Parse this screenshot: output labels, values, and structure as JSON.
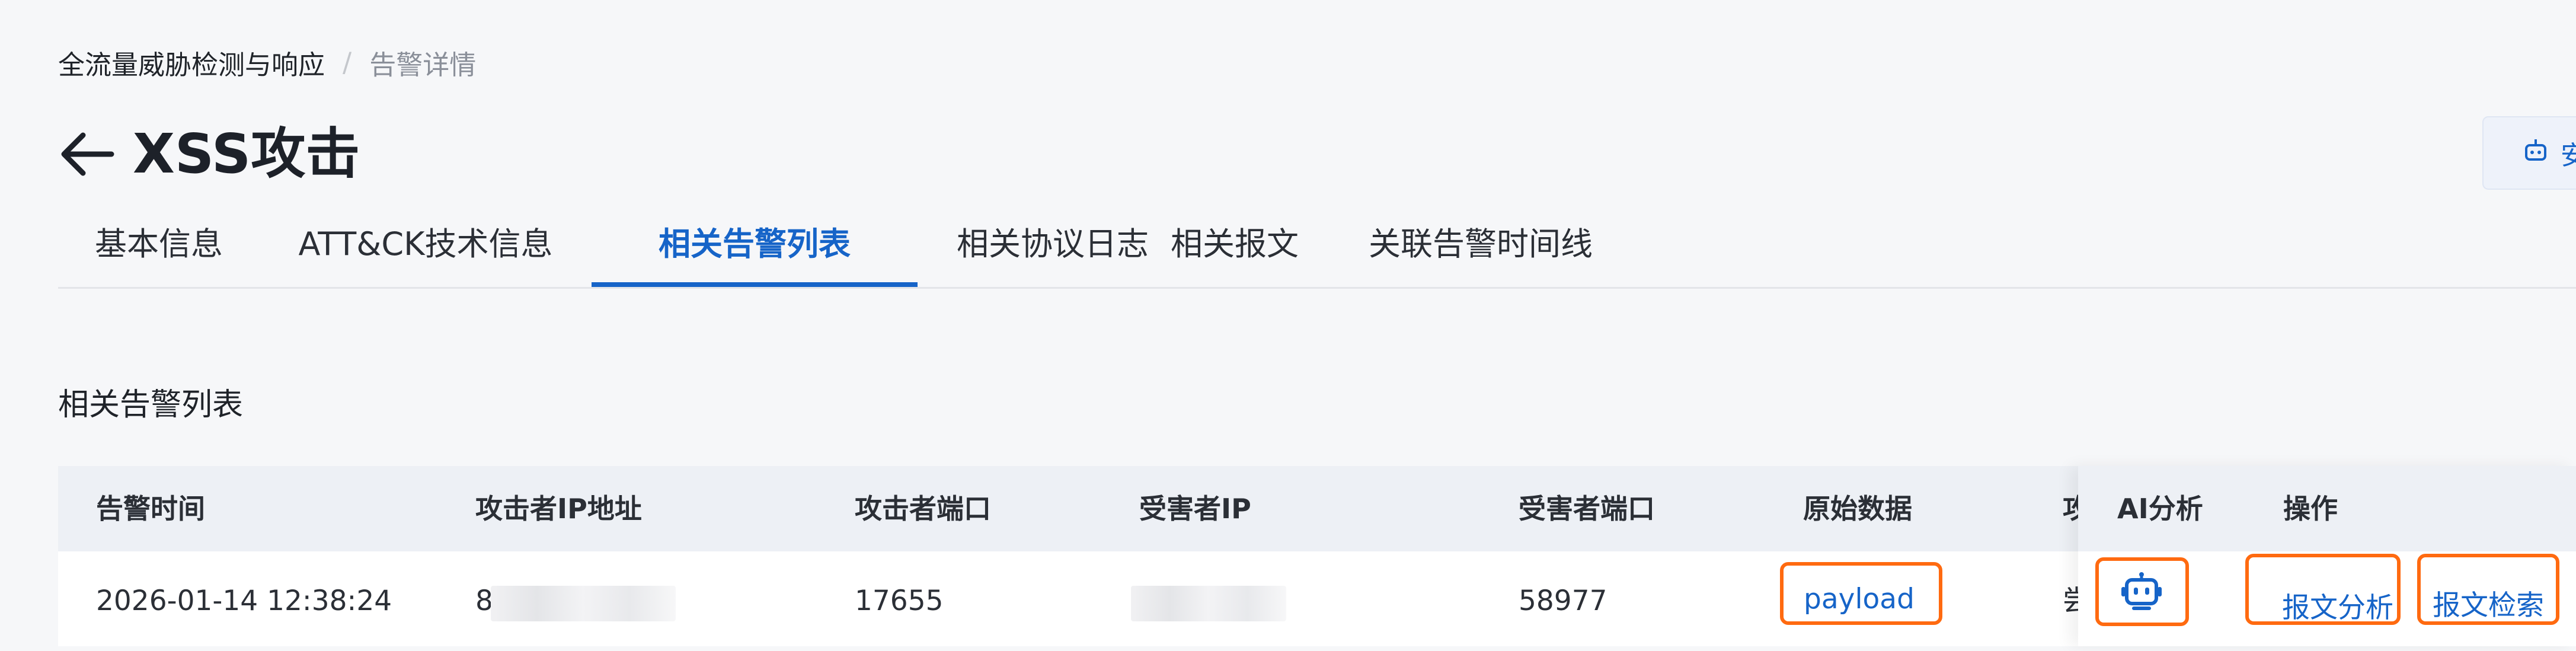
{
  "breadcrumb": {
    "root": "全流量威胁检测与响应",
    "separator": "/",
    "current": "告警详情"
  },
  "header": {
    "title": "XSS攻击",
    "back_icon": "arrow-left-icon",
    "right_button_label": "安",
    "right_button_icon": "robot-icon"
  },
  "tabs": [
    {
      "label": "基本信息",
      "active": false
    },
    {
      "label": "ATT&CK技术信息",
      "active": false
    },
    {
      "label": "相关告警列表",
      "active": true
    },
    {
      "label": "相关协议日志",
      "active": false
    },
    {
      "label": "相关报文",
      "active": false
    },
    {
      "label": "关联告警时间线",
      "active": false
    }
  ],
  "section": {
    "title": "相关告警列表"
  },
  "table": {
    "columns": [
      "告警时间",
      "攻击者IP地址",
      "攻击者端口",
      "受害者IP",
      "受害者端口",
      "原始数据",
      "攻",
      "AI分析",
      "操作"
    ],
    "rows": [
      {
        "alert_time": "2026-01-14 12:38:24",
        "attacker_ip_visible": "8",
        "attacker_port": "17655",
        "victim_ip_visible": "",
        "victim_port": "58977",
        "raw_data": "payload",
        "truncated_col": "尝",
        "ai_icon": "robot-icon",
        "actions": [
          "报文分析",
          "报文检索"
        ]
      }
    ]
  },
  "colors": {
    "accent": "#1664c8",
    "highlight_box": "#ff6a10",
    "header_bg": "#edf0f5"
  }
}
